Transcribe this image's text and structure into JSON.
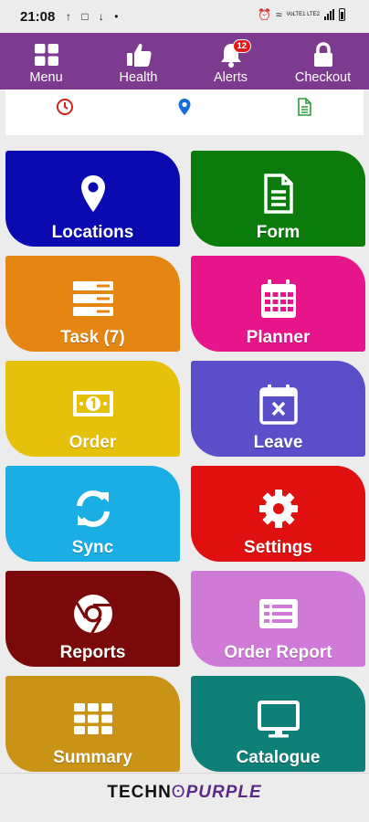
{
  "status_bar": {
    "time": "21:08",
    "left_icons": "↑ □ ↓ •",
    "network": "VoLTE1 LTE2",
    "icons": [
      "alarm-icon",
      "wifi-icon",
      "signal-icon",
      "battery-icon"
    ]
  },
  "nav": {
    "items": [
      {
        "label": "Menu",
        "icon": "grid-icon"
      },
      {
        "label": "Health",
        "icon": "thumbs-up-icon"
      },
      {
        "label": "Alerts",
        "icon": "bell-icon",
        "badge": "12"
      },
      {
        "label": "Checkout",
        "icon": "lock-icon"
      }
    ]
  },
  "info_strip": {
    "icons": [
      {
        "name": "clock-icon",
        "color": "#d62020"
      },
      {
        "name": "location-icon",
        "color": "#1a6dd6"
      },
      {
        "name": "document-icon",
        "color": "#2e9b3a"
      }
    ]
  },
  "tiles": [
    {
      "label": "Locations",
      "icon": "map-marker-icon",
      "color": "#0a0ab0"
    },
    {
      "label": "Form",
      "icon": "document-icon",
      "color": "#0b7c0b"
    },
    {
      "label": "Task (7)",
      "icon": "server-icon",
      "color": "#e58512"
    },
    {
      "label": "Planner",
      "icon": "calendar-icon",
      "color": "#e6158a"
    },
    {
      "label": "Order",
      "icon": "money-icon",
      "color": "#e5c10c"
    },
    {
      "label": "Leave",
      "icon": "calendar-x-icon",
      "color": "#5a4fc8"
    },
    {
      "label": "Sync",
      "icon": "refresh-icon",
      "color": "#1aaee4"
    },
    {
      "label": "Settings",
      "icon": "gear-icon",
      "color": "#e01010"
    },
    {
      "label": "Reports",
      "icon": "chrome-icon",
      "color": "#7a0a0a"
    },
    {
      "label": "Order Report",
      "icon": "list-card-icon",
      "color": "#d07ad8"
    },
    {
      "label": "Summary",
      "icon": "grid-icon",
      "color": "#c89316"
    },
    {
      "label": "Catalogue",
      "icon": "monitor-icon",
      "color": "#0f8077"
    }
  ],
  "footer": {
    "brand_left": "TECHN",
    "brand_sep": "ʘ",
    "brand_right": "PURPLE"
  }
}
